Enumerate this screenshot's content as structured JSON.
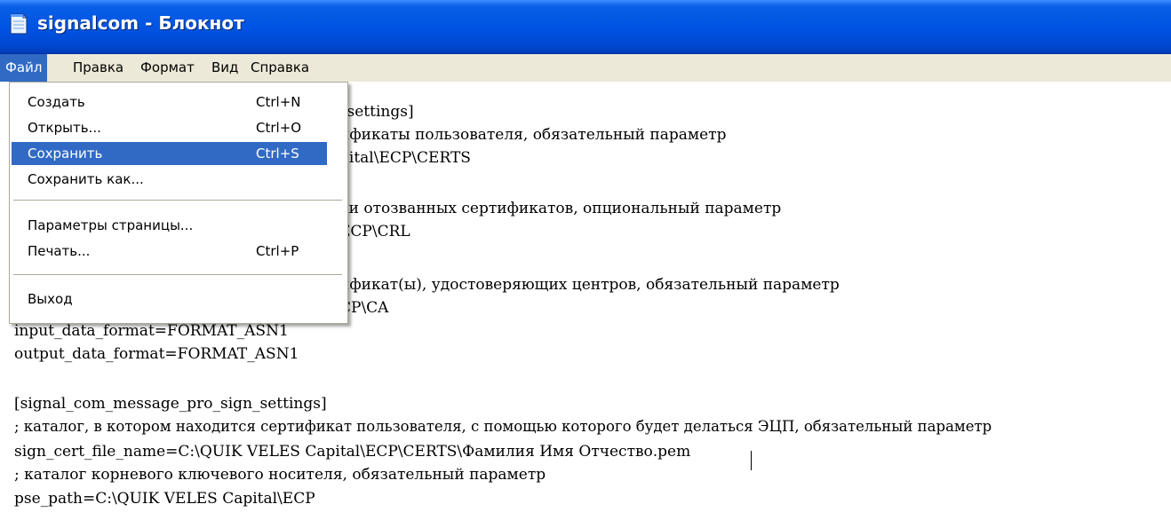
{
  "window": {
    "title": "signalcom - Блокнот",
    "icon": "notepad-icon"
  },
  "menubar": {
    "items": [
      "Файл",
      "Правка",
      "Формат",
      "Вид",
      "Справка"
    ],
    "active_index": 0
  },
  "file_menu": {
    "items": [
      {
        "label": "Создать",
        "shortcut": "Ctrl+N"
      },
      {
        "label": "Открыть...",
        "shortcut": "Ctrl+O"
      },
      {
        "label": "Сохранить",
        "shortcut": "Ctrl+S"
      },
      {
        "label": "Сохранить как...",
        "shortcut": ""
      },
      {
        "label": "Параметры страницы...",
        "shortcut": ""
      },
      {
        "label": "Печать...",
        "shortcut": "Ctrl+P"
      },
      {
        "label": "Выход",
        "shortcut": ""
      }
    ],
    "highlighted_index": 2
  },
  "editor": {
    "lines": [
      "_settings]",
      "ификаты пользователя, обязательный параметр",
      "pital\\ECP\\CERTS",
      "",
      "ки отозванных сертификатов, опциональный параметр",
      "ECP\\CRL",
      "",
      "ификат(ы), удостоверяющих центров, обязательный параметр",
      "CP\\CA",
      "input_data_format=FORMAT_ASN1",
      "output_data_format=FORMAT_ASN1",
      "",
      "[signal_com_message_pro_sign_settings]",
      "; каталог, в котором находится сертификат пользователя, с помощью которого будет делаться ЭЦП, обязательный параметр",
      "sign_cert_file_name=C:\\QUIK VELES Capital\\ECP\\CERTS\\Фамилия Имя Отчество.pem",
      "; каталог корневого ключевого носителя, обязательный параметр",
      "pse_path=C:\\QUIK VELES Capital\\ECP"
    ]
  },
  "colors": {
    "titlebar": "#0054e3",
    "menubar": "#ece9d8",
    "highlight": "#316ac5"
  }
}
